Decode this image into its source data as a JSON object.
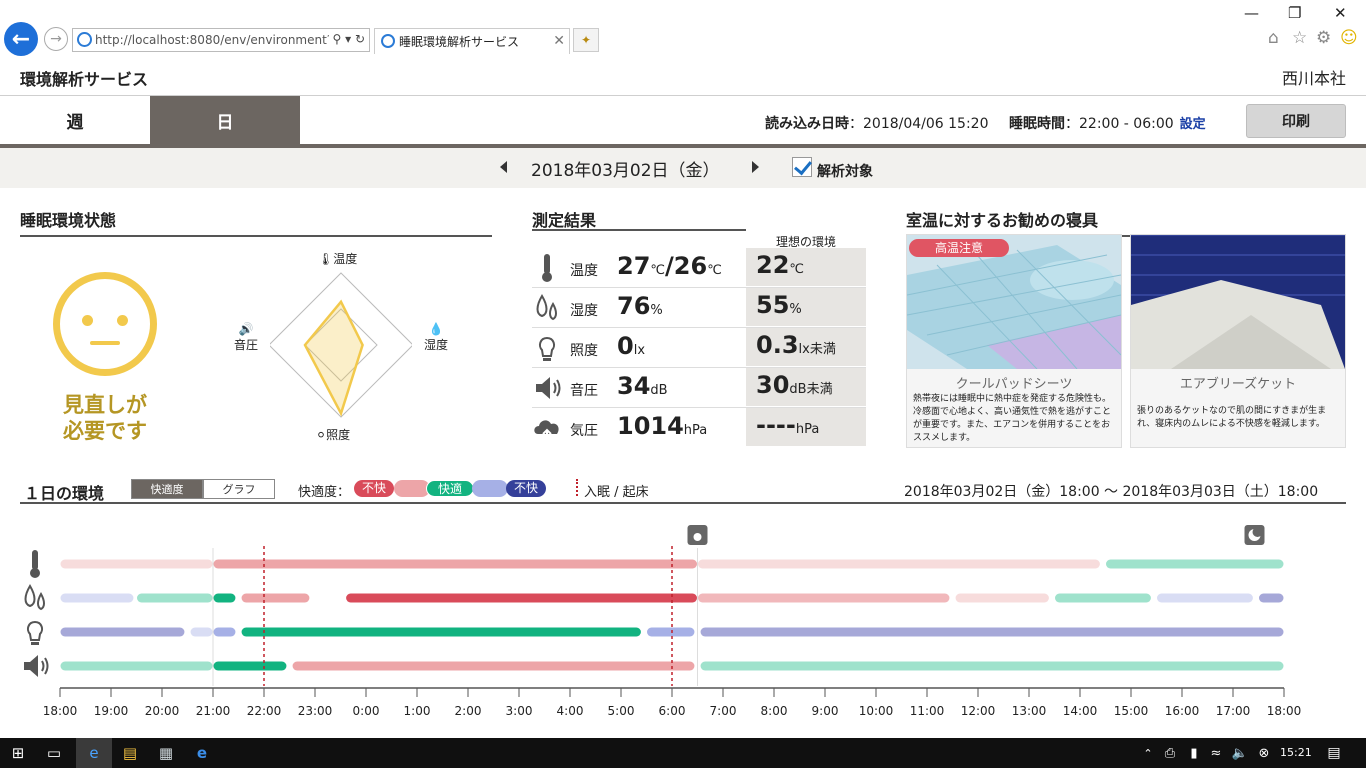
{
  "browser": {
    "url": "http://localhost:8080/env/environment?d",
    "tab_title": "睡眠環境解析サービス"
  },
  "header": {
    "app_title": "環境解析サービス",
    "store_name": "西川本社",
    "tabs": [
      {
        "label": "週"
      },
      {
        "label": "日"
      }
    ],
    "load_label": "読み込み日時",
    "load_value": "：2018/04/06 15:20",
    "sleep_label": "睡眠時間",
    "sleep_value": "：22:00 - 06:00",
    "setting_link": "設定",
    "print_button": "印刷"
  },
  "datebar": {
    "date": "2018年03月02日（金）",
    "analysis_label": "解析対象",
    "analysis_checked": true
  },
  "status": {
    "title": "睡眠環境状態",
    "message_line1": "見直しが",
    "message_line2": "必要です",
    "face_color": "#f2c94c",
    "radar_labels": [
      "温度",
      "湿度",
      "照度",
      "音圧"
    ],
    "radar_values": [
      0.6,
      0.3,
      0.95,
      0.5
    ]
  },
  "measurement": {
    "title": "測定結果",
    "ideal_header": "理想の環境",
    "rows": [
      {
        "icon": "thermometer-icon",
        "label": "温度",
        "value": "27",
        "unit": "℃",
        "value2": "/26",
        "unit2": "℃",
        "ideal": "22",
        "ideal_unit": "℃"
      },
      {
        "icon": "humidity-icon",
        "label": "湿度",
        "value": "76",
        "unit": "%",
        "value2": "",
        "unit2": "",
        "ideal": "55",
        "ideal_unit": "%"
      },
      {
        "icon": "lightbulb-icon",
        "label": "照度",
        "value": "0",
        "unit": "lx",
        "value2": "",
        "unit2": "",
        "ideal": "0.3",
        "ideal_unit": "lx未満"
      },
      {
        "icon": "speaker-icon",
        "label": "音圧",
        "value": "34",
        "unit": "dB",
        "value2": "",
        "unit2": "",
        "ideal": "30",
        "ideal_unit": "dB未満"
      },
      {
        "icon": "cloud-pressure-icon",
        "label": "気圧",
        "value": "1014",
        "unit": "hPa",
        "value2": "",
        "unit2": "",
        "ideal": "----",
        "ideal_unit": "hPa"
      }
    ]
  },
  "recommend": {
    "title": "室温に対するお勧めの寝具",
    "badge": "高温注意",
    "products": [
      {
        "name": "クールパッドシーツ",
        "desc": "熱帯夜には睡眠中に熱中症を発症する危険性も。冷感面で心地よく、高い通気性で熱を逃がすことが重要です。また、エアコンを併用することをおススメします。"
      },
      {
        "name": "エアブリーズケット",
        "desc": "張りのあるケットなので肌の間にすきまが生まれ、寝床内のムレによる不快感を軽減します。"
      }
    ]
  },
  "day_env": {
    "title": "１日の環境",
    "toggle_comfort": "快適度",
    "toggle_graph": "グラフ",
    "legend_label": "快適度：",
    "legend": [
      {
        "label": "不快",
        "color": "#d94b5a"
      },
      {
        "label": "",
        "color": "#eda5a8"
      },
      {
        "label": "快適",
        "color": "#12b380"
      },
      {
        "label": "",
        "color": "#a6b0e6"
      },
      {
        "label": "不快",
        "color": "#35409a"
      }
    ],
    "sleep_legend": "入眠 / 起床",
    "range": "2018年03月02日（金）18:00 〜 2018年03月03日（土）18:00",
    "hours": [
      "18:00",
      "19:00",
      "20:00",
      "21:00",
      "22:00",
      "23:00",
      "0:00",
      "1:00",
      "2:00",
      "3:00",
      "4:00",
      "5:00",
      "6:00",
      "7:00",
      "8:00",
      "9:00",
      "10:00",
      "11:00",
      "12:00",
      "13:00",
      "14:00",
      "15:00",
      "16:00",
      "17:00",
      "18:00"
    ],
    "sleep_start_hour": 4,
    "wake_hour": 12,
    "day_start_hour": 12.5,
    "night_start_hour": 23.5,
    "rows": [
      {
        "name": "temperature",
        "segments": [
          {
            "from": 0,
            "to": 3,
            "color": "#f7dcdc"
          },
          {
            "from": 3,
            "to": 12.5,
            "color": "#eda5a8"
          },
          {
            "from": 12.5,
            "to": 20.4,
            "color": "#f7dcdc"
          },
          {
            "from": 20.5,
            "to": 24,
            "color": "#9fe2cc"
          }
        ]
      },
      {
        "name": "humidity",
        "segments": [
          {
            "from": 0,
            "to": 1.45,
            "color": "#d9ddf4"
          },
          {
            "from": 1.5,
            "to": 3.0,
            "color": "#9fe2cc"
          },
          {
            "from": 3.0,
            "to": 3.45,
            "color": "#12b380"
          },
          {
            "from": 3.55,
            "to": 4.9,
            "color": "#eda5a8"
          },
          {
            "from": 5.6,
            "to": 12.5,
            "color": "#d94b5a"
          },
          {
            "from": 12.5,
            "to": 17.45,
            "color": "#f1b8bb"
          },
          {
            "from": 17.55,
            "to": 19.4,
            "color": "#f7dcdc"
          },
          {
            "from": 19.5,
            "to": 21.4,
            "color": "#9fe2cc"
          },
          {
            "from": 21.5,
            "to": 23.4,
            "color": "#d9ddf4"
          },
          {
            "from": 23.5,
            "to": 24,
            "color": "#a6a8d8"
          }
        ]
      },
      {
        "name": "illuminance",
        "segments": [
          {
            "from": 0,
            "to": 2.45,
            "color": "#a6a8d8"
          },
          {
            "from": 2.55,
            "to": 3.0,
            "color": "#d9ddf4"
          },
          {
            "from": 3.0,
            "to": 3.45,
            "color": "#a6b0e6"
          },
          {
            "from": 3.55,
            "to": 11.4,
            "color": "#12b380"
          },
          {
            "from": 11.5,
            "to": 12.45,
            "color": "#a6b0e6"
          },
          {
            "from": 12.55,
            "to": 24,
            "color": "#a6a8d8"
          }
        ]
      },
      {
        "name": "sound",
        "segments": [
          {
            "from": 0,
            "to": 3,
            "color": "#9fe2cc"
          },
          {
            "from": 3,
            "to": 4.45,
            "color": "#12b380"
          },
          {
            "from": 4.55,
            "to": 12.45,
            "color": "#eda5a8"
          },
          {
            "from": 12.55,
            "to": 24,
            "color": "#9fe2cc"
          }
        ]
      }
    ]
  },
  "taskbar": {
    "clock": "15:21"
  }
}
